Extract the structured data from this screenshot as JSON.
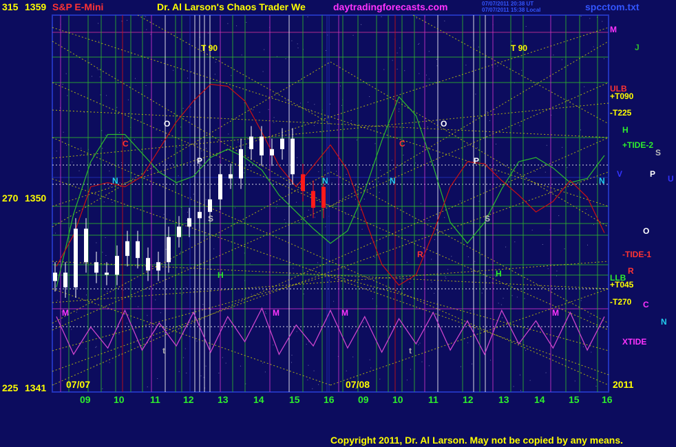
{
  "header": {
    "symbol": "S&P E-Mini",
    "title": "Dr. Al Larson's Chaos Trader We",
    "site": "daytradingforecasts.com",
    "stamp_line1": "07/07/2011 20:38 UT",
    "stamp_line2": "07/07/2011 15:38 Local",
    "file": "spcctom.txt"
  },
  "footer": {
    "copyright": "Copyright 2011, Dr. Al Larson. May not be copied by any means."
  },
  "colors": {
    "background": "#0c0c5e",
    "price_up": "#ffffff",
    "price_down": "#ff1a1a",
    "tide_green": "#2dbd2d",
    "tide_red": "#cc1111",
    "xtide": "#cc44cc",
    "grid_yellow": "#d8d800",
    "label_yellow": "#ffff00",
    "label_magenta": "#ff33ff",
    "label_cyan": "#22ccee"
  },
  "chart_data": {
    "type": "line",
    "y_left_labels": [
      {
        "price": "1359",
        "angle": "315"
      },
      {
        "price": "1350",
        "angle": "270"
      },
      {
        "price": "1341",
        "angle": "225"
      }
    ],
    "ylim": [
      1341,
      1359
    ],
    "x_day_labels": [
      "09",
      "10",
      "11",
      "12",
      "13",
      "14",
      "15",
      "16",
      "09",
      "10",
      "11",
      "12",
      "13",
      "14",
      "15",
      "16"
    ],
    "date_labels": [
      "07/07",
      "07/08",
      "2011"
    ],
    "series": [
      {
        "name": "+TIDE-2",
        "color": "#2dbd2d",
        "values": [
          1346.0,
          1349.5,
          1352.0,
          1353.3,
          1353.3,
          1352.4,
          1351.5,
          1351.0,
          1351.3,
          1352.2,
          1352.6,
          1352.2,
          1351.6,
          1350.4,
          1349.6,
          1348.8,
          1348.1,
          1348.7,
          1350.6,
          1353.0,
          1355.1,
          1354.2,
          1351.8,
          1349.1,
          1348.1,
          1349.1,
          1350.7,
          1352.0,
          1352.2,
          1351.7,
          1351.0,
          1351.2,
          1352.3
        ]
      },
      {
        "name": "-TIDE-1",
        "color": "#cc1111",
        "values": [
          1347.0,
          1348.5,
          1350.8,
          1351.0,
          1350.8,
          1351.3,
          1352.6,
          1353.9,
          1354.9,
          1355.7,
          1355.6,
          1354.9,
          1353.4,
          1351.8,
          1350.8,
          1351.8,
          1352.8,
          1351.6,
          1349.3,
          1347.1,
          1346.1,
          1346.6,
          1348.6,
          1350.8,
          1352.0,
          1351.9,
          1351.1,
          1350.4,
          1349.6,
          1350.1,
          1351.1,
          1350.3,
          1348.6
        ]
      },
      {
        "name": "XTIDE",
        "color": "#cc44cc",
        "values": [
          1344.6,
          1342.8,
          1344.1,
          1343.1,
          1344.9,
          1343.0,
          1344.3,
          1343.2,
          1344.8,
          1342.9,
          1344.6,
          1343.4,
          1345.0,
          1342.8,
          1344.2,
          1343.2,
          1344.9,
          1343.1,
          1344.6,
          1342.9,
          1344.5,
          1343.3,
          1344.8,
          1343.0,
          1344.4,
          1342.8,
          1344.9,
          1343.3,
          1344.4,
          1343.1,
          1344.8,
          1343.0,
          1344.6
        ]
      },
      {
        "name": "S&P E-Mini",
        "color": "#ffffff",
        "values": [
          1346.7,
          1346.0,
          1348.8,
          1347.2,
          1346.7,
          1346.6,
          1347.5,
          1348.2,
          1347.4,
          1346.8,
          1347.2,
          1348.4,
          1348.9,
          1349.3,
          1349.6,
          1350.2,
          1351.4,
          1351.2,
          1352.6,
          1353.2,
          1352.3,
          1352.6,
          1353.1,
          1351.4,
          1350.6,
          1349.8,
          1350.8
        ]
      }
    ],
    "right_labels": [
      {
        "text": "M",
        "color": "#ff33ff"
      },
      {
        "text": "J",
        "color": "#2dbd2d"
      },
      {
        "text": "ULB",
        "color": "#ff3333"
      },
      {
        "text": "+T090",
        "color": "#ffff00"
      },
      {
        "text": "-T225",
        "color": "#ffff00"
      },
      {
        "text": "H",
        "color": "#2dee2d"
      },
      {
        "text": "+TIDE-2",
        "color": "#2dee2d"
      },
      {
        "text": "S",
        "color": "#bbbbbb"
      },
      {
        "text": "V",
        "color": "#3333ff"
      },
      {
        "text": "P",
        "color": "#ffffff"
      },
      {
        "text": "U",
        "color": "#3333ff"
      },
      {
        "text": "O",
        "color": "#ffffff"
      },
      {
        "text": "-TIDE-1",
        "color": "#ff3333"
      },
      {
        "text": "R",
        "color": "#ff3333"
      },
      {
        "text": "LLB",
        "color": "#2dee2d"
      },
      {
        "text": "+T045",
        "color": "#ffff00"
      },
      {
        "text": "-T270",
        "color": "#ffff00"
      },
      {
        "text": "C",
        "color": "#ff33ff"
      },
      {
        "text": "N",
        "color": "#22ccee"
      },
      {
        "text": "XTIDE",
        "color": "#ff33ff"
      }
    ],
    "in_chart_labels": [
      {
        "text": "T 90",
        "color": "#ffff00"
      },
      {
        "text": "T 90",
        "color": "#ffff00"
      },
      {
        "text": "O",
        "color": "#ffffff"
      },
      {
        "text": "O",
        "color": "#ffffff"
      },
      {
        "text": "C",
        "color": "#ff3333"
      },
      {
        "text": "C",
        "color": "#ff3333"
      },
      {
        "text": "P",
        "color": "#ffffff"
      },
      {
        "text": "P",
        "color": "#ffffff"
      },
      {
        "text": "N",
        "color": "#22ccee"
      },
      {
        "text": "N",
        "color": "#22ccee"
      },
      {
        "text": "N",
        "color": "#22ccee"
      },
      {
        "text": "N",
        "color": "#22ccee"
      },
      {
        "text": "S",
        "color": "#bbbbbb"
      },
      {
        "text": "S",
        "color": "#bbbbbb"
      },
      {
        "text": "H",
        "color": "#2dee2d"
      },
      {
        "text": "H",
        "color": "#2dee2d"
      },
      {
        "text": "R",
        "color": "#ff3333"
      },
      {
        "text": "M",
        "color": "#ff33ff"
      },
      {
        "text": "M",
        "color": "#ff33ff"
      },
      {
        "text": "M",
        "color": "#ff33ff"
      },
      {
        "text": "M",
        "color": "#ff33ff"
      },
      {
        "text": "t",
        "color": "#aaaaaa"
      },
      {
        "text": "t",
        "color": "#aaaaaa"
      }
    ]
  }
}
